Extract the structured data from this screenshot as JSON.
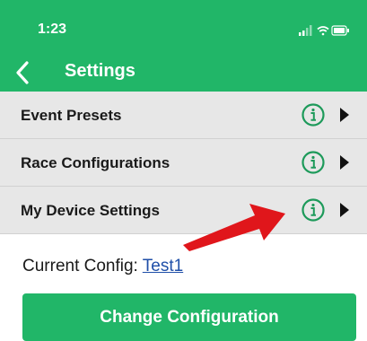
{
  "status_bar": {
    "time": "1:23",
    "icons": [
      "signal-icon",
      "wifi-icon",
      "battery-icon"
    ]
  },
  "nav": {
    "title": "Settings",
    "back_icon": "chevron-left-icon"
  },
  "settings_rows": [
    {
      "label": "Event Presets",
      "info_icon": "info-icon",
      "arrow_icon": "triangle-right-icon"
    },
    {
      "label": "Race Configurations",
      "info_icon": "info-icon",
      "arrow_icon": "triangle-right-icon"
    },
    {
      "label": "My Device Settings",
      "info_icon": "info-icon",
      "arrow_icon": "triangle-right-icon"
    }
  ],
  "current_config": {
    "label": "Current Config: ",
    "value": "Test1"
  },
  "change_button": {
    "label": "Change Configuration"
  },
  "colors": {
    "brand_green": "#21b668",
    "row_bg": "#e7e7e7",
    "link_blue": "#1f4fa8",
    "annotation_red": "#e0161b"
  }
}
